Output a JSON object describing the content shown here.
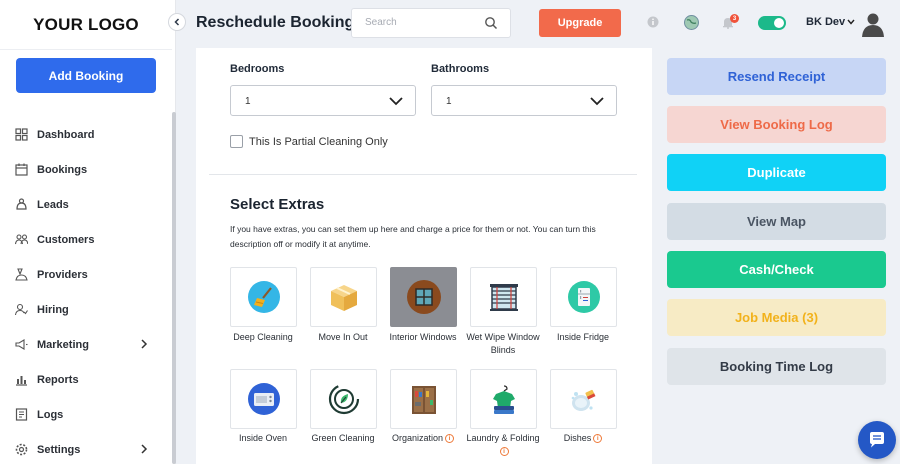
{
  "sidebar": {
    "logo": "YOUR LOGO",
    "add_booking": "Add Booking",
    "items": [
      {
        "label": "Dashboard",
        "icon": "dashboard-icon"
      },
      {
        "label": "Bookings",
        "icon": "calendar-icon"
      },
      {
        "label": "Leads",
        "icon": "funnel-icon"
      },
      {
        "label": "Customers",
        "icon": "customers-icon"
      },
      {
        "label": "Providers",
        "icon": "providers-icon"
      },
      {
        "label": "Hiring",
        "icon": "hiring-icon"
      },
      {
        "label": "Marketing",
        "icon": "marketing-icon",
        "has_submenu": true
      },
      {
        "label": "Reports",
        "icon": "reports-icon"
      },
      {
        "label": "Logs",
        "icon": "logs-icon"
      },
      {
        "label": "Settings",
        "icon": "gear-icon",
        "has_submenu": true
      }
    ]
  },
  "header": {
    "title": "Reschedule Booking",
    "search_placeholder": "Search",
    "upgrade": "Upgrade",
    "notification_count": "3",
    "user_name": "BK Dev"
  },
  "form": {
    "bedrooms_label": "Bedrooms",
    "bedrooms_value": "1",
    "bathrooms_label": "Bathrooms",
    "bathrooms_value": "1",
    "partial_label": "This Is Partial Cleaning Only",
    "partial_checked": false
  },
  "extras": {
    "title": "Select Extras",
    "description": "If you have extras, you can set them up here and charge a price for them or not. You can turn this description off or modify it at anytime.",
    "items": [
      {
        "label": "Deep Cleaning",
        "icon": "broom-icon",
        "selected": false,
        "info": false
      },
      {
        "label": "Move In Out",
        "icon": "box-icon",
        "selected": false,
        "info": false
      },
      {
        "label": "Interior Windows",
        "icon": "window-icon",
        "selected": true,
        "info": false
      },
      {
        "label": "Wet Wipe Window Blinds",
        "icon": "blinds-icon",
        "selected": false,
        "info": false
      },
      {
        "label": "Inside Fridge",
        "icon": "fridge-icon",
        "selected": false,
        "info": false
      },
      {
        "label": "Inside Oven",
        "icon": "oven-icon",
        "selected": false,
        "info": false
      },
      {
        "label": "Green Cleaning",
        "icon": "eco-icon",
        "selected": false,
        "info": false
      },
      {
        "label": "Organization",
        "icon": "cabinet-icon",
        "selected": false,
        "info": true
      },
      {
        "label": "Laundry & Folding",
        "icon": "laundry-icon",
        "selected": false,
        "info": true
      },
      {
        "label": "Dishes",
        "icon": "dishes-icon",
        "selected": false,
        "info": true
      }
    ]
  },
  "actions": [
    {
      "label": "Resend Receipt",
      "bg": "#c7d6f5",
      "color": "#2f62d6"
    },
    {
      "label": "View Booking Log",
      "bg": "#f6d6d2",
      "color": "#ee6a48"
    },
    {
      "label": "Duplicate",
      "bg": "#10d2f6",
      "color": "#ffffff"
    },
    {
      "label": "View Map",
      "bg": "#d3dce4",
      "color": "#4a5563"
    },
    {
      "label": "Cash/Check",
      "bg": "#1ac98f",
      "color": "#ffffff"
    },
    {
      "label": "Job Media (3)",
      "bg": "#f7ebc5",
      "color": "#f2b21b"
    },
    {
      "label": "Booking Time Log",
      "bg": "#dfe4e9",
      "color": "#333b47"
    }
  ],
  "colors": {
    "primary": "#2f6bec",
    "upgrade": "#f26a4b",
    "toggle_on": "#1cb98a",
    "chat": "#2458c6"
  }
}
